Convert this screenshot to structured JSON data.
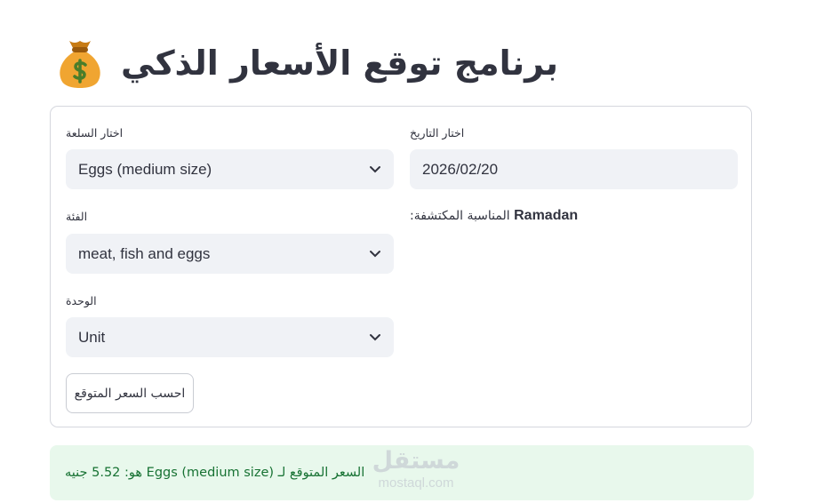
{
  "header": {
    "title": "برنامج توقع الأسعار الذكي",
    "icon": "money-bag-icon"
  },
  "form": {
    "commodity": {
      "label": "اختار السلعة",
      "value": "Eggs (medium size)"
    },
    "category": {
      "label": "الفئة",
      "value": "meat, fish and eggs"
    },
    "unit": {
      "label": "الوحدة",
      "value": "Unit"
    },
    "date": {
      "label": "اختار التاريخ",
      "value": "2026/02/20"
    },
    "occasion": {
      "label": "المناسبة المكتشفة:",
      "value": "Ramadan"
    },
    "submit_label": "احسب السعر المتوقع"
  },
  "result": {
    "text": "السعر المتوقع لـ Eggs (medium size) هو: 5.52 جنيه"
  },
  "watermark": {
    "arabic": "مستقل",
    "latin": "mostaql.com"
  },
  "colors": {
    "input_bg": "#f0f2f6",
    "result_bg": "#e8f8ec",
    "result_text": "#177233",
    "text": "#31333f"
  }
}
